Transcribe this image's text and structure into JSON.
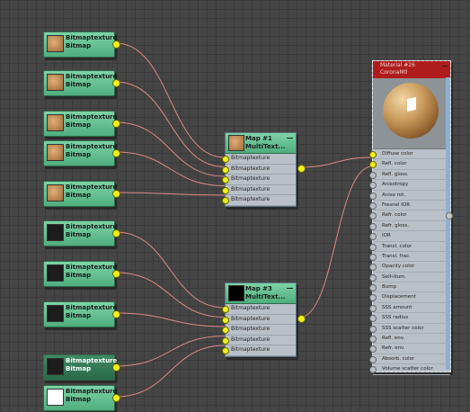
{
  "bitmap_nodes": [
    {
      "title": "Bitmaptexture",
      "subtitle": "Bitmap",
      "thumb": "#c08a55"
    },
    {
      "title": "Bitmaptexture",
      "subtitle": "Bitmap",
      "thumb": "#c08a55"
    },
    {
      "title": "Bitmaptexture",
      "subtitle": "Bitmap",
      "thumb": "#c08a55"
    },
    {
      "title": "Bitmaptexture",
      "subtitle": "Bitmap",
      "thumb": "#c08a55"
    },
    {
      "title": "Bitmaptexture",
      "subtitle": "Bitmap",
      "thumb": "#c08a55"
    },
    {
      "title": "Bitmaptexture",
      "subtitle": "Bitmap",
      "thumb": "#1c1c1c"
    },
    {
      "title": "Bitmaptexture",
      "subtitle": "Bitmap",
      "thumb": "#1c1c1c"
    },
    {
      "title": "Bitmaptexture",
      "subtitle": "Bitmap",
      "thumb": "#1c1c1c"
    },
    {
      "title": "Bitmaptexture",
      "subtitle": "Bitmap",
      "thumb": "#1c1c1c"
    },
    {
      "title": "Bitmaptexture",
      "subtitle": "Bitmap",
      "thumb": "#ffffff"
    }
  ],
  "map1": {
    "title": "Map #1",
    "subtitle": "MultiText...",
    "thumb": "#c08a55",
    "slots": [
      "Bitmaptexture",
      "Bitmaptexture",
      "Bitmaptexture",
      "Bitmaptexture",
      "Bitmaptexture"
    ]
  },
  "map3": {
    "title": "Map #3",
    "subtitle": "MultiText...",
    "thumb": "#000000",
    "slots": [
      "Bitmaptexture",
      "Bitmaptexture",
      "Bitmaptexture",
      "Bitmaptexture",
      "Bitmaptexture"
    ]
  },
  "material": {
    "title": "Material #26",
    "subtitle": "CoronaMtl",
    "header_color": "#b01c1c",
    "slots": [
      "Diffuse color",
      "Refl. color",
      "Refl. gloss.",
      "Anisotropy",
      "Aniso rot.",
      "Fresnel IOR",
      "Refr. color",
      "Refr. gloss.",
      "IOR",
      "Transl. color",
      "Transl. frac.",
      "Opacity color",
      "Self-illum.",
      "Bump",
      "Displacement",
      "SSS amount",
      "SSS radius",
      "SSS scatter color",
      "Refl. env.",
      "Refr. env.",
      "Absorb. color",
      "Volume scatter color"
    ]
  },
  "colors": {
    "wire": "#e08a84",
    "port": "#f0f01e",
    "node_green": "#6cc896",
    "node_header_red": "#b01c1c",
    "slot_bg": "#b9c0c8",
    "grid": "#454545"
  }
}
